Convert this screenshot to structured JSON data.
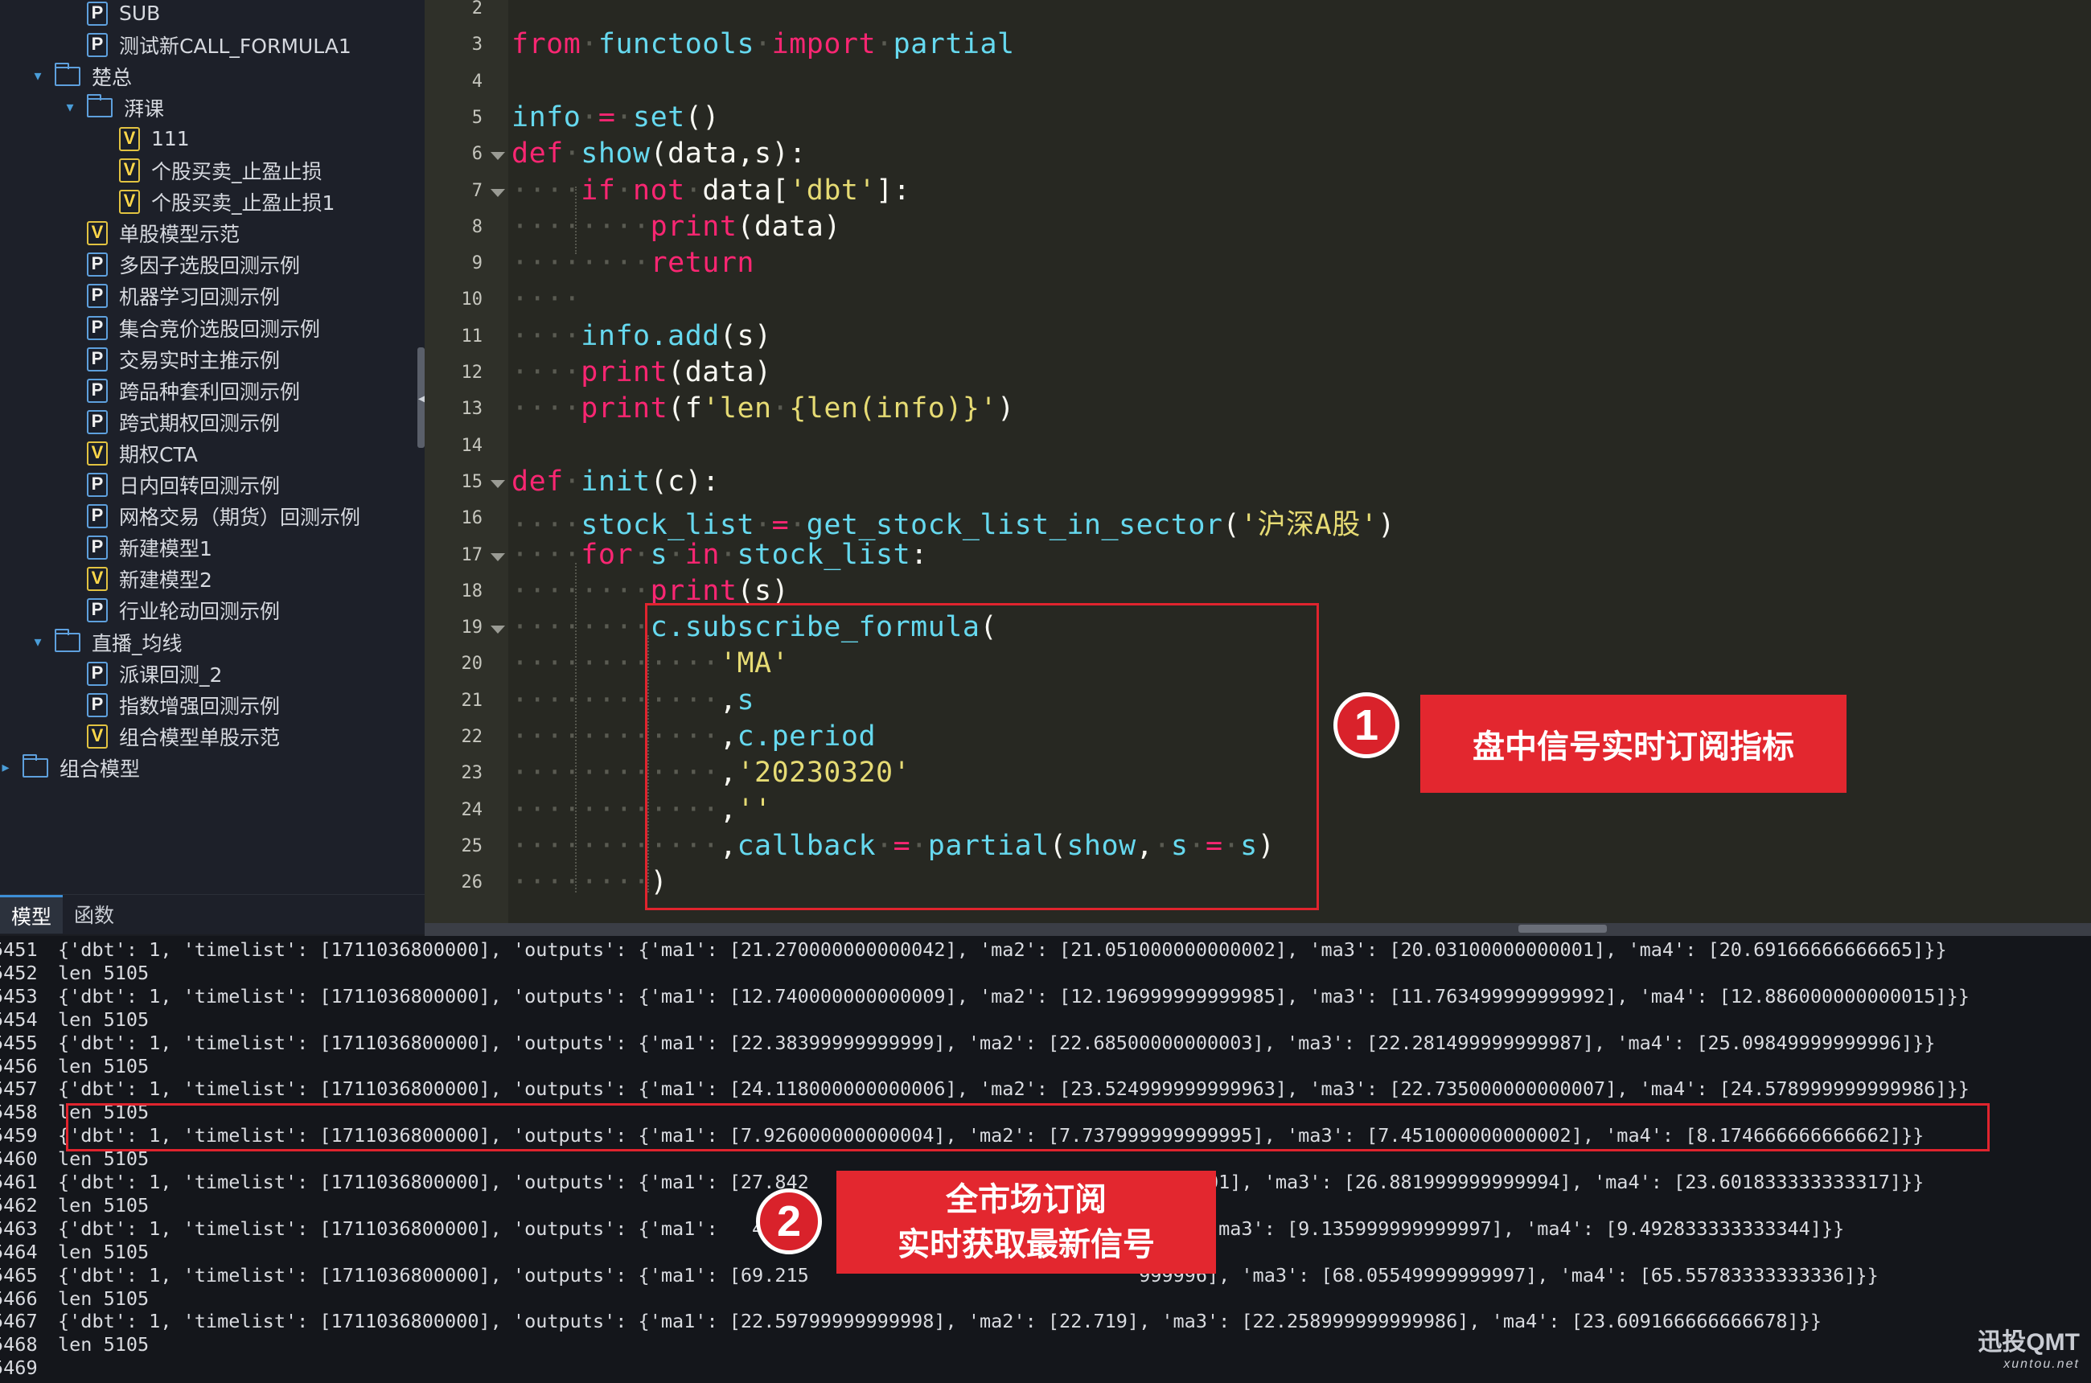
{
  "sidebar": {
    "tree": [
      {
        "label": "SUB",
        "type": "P",
        "expanded": null
      },
      {
        "label": "测试新CALL_FORMULA1",
        "type": "P",
        "expanded": null
      },
      {
        "label": "楚总",
        "type": "folder",
        "expanded": true
      },
      {
        "label": "湃课",
        "type": "folder",
        "expanded": true
      },
      {
        "label": "111",
        "type": "V",
        "expanded": null
      },
      {
        "label": "个股买卖_止盈止损",
        "type": "V",
        "expanded": null
      },
      {
        "label": "个股买卖_止盈止损1",
        "type": "V",
        "expanded": null
      },
      {
        "label": "单股模型示范",
        "type": "V",
        "expanded": null
      },
      {
        "label": "多因子选股回测示例",
        "type": "P",
        "expanded": null
      },
      {
        "label": "机器学习回测示例",
        "type": "P",
        "expanded": null
      },
      {
        "label": "集合竞价选股回测示例",
        "type": "P",
        "expanded": null
      },
      {
        "label": "交易实时主推示例",
        "type": "P",
        "expanded": null
      },
      {
        "label": "跨品种套利回测示例",
        "type": "P",
        "expanded": null
      },
      {
        "label": "跨式期权回测示例",
        "type": "P",
        "expanded": null
      },
      {
        "label": "期权CTA",
        "type": "V",
        "expanded": null
      },
      {
        "label": "日内回转回测示例",
        "type": "P",
        "expanded": null
      },
      {
        "label": "网格交易（期货）回测示例",
        "type": "P",
        "expanded": null
      },
      {
        "label": "新建模型1",
        "type": "P",
        "expanded": null
      },
      {
        "label": "新建模型2",
        "type": "V",
        "expanded": null
      },
      {
        "label": "行业轮动回测示例",
        "type": "P",
        "expanded": null
      },
      {
        "label": "直播_均线",
        "type": "folder",
        "expanded": true
      },
      {
        "label": "派课回测_2",
        "type": "P",
        "expanded": null
      },
      {
        "label": "指数增强回测示例",
        "type": "P",
        "expanded": null
      },
      {
        "label": "组合模型单股示范",
        "type": "V",
        "expanded": null
      },
      {
        "label": "组合模型",
        "type": "folder",
        "expanded": false
      }
    ],
    "tabs": [
      "模型",
      "函数"
    ]
  },
  "editor": {
    "lines": [
      {
        "n": "2",
        "fold": false,
        "tokens": []
      },
      {
        "n": "3",
        "fold": false,
        "tokens": [
          [
            "kw",
            "from"
          ],
          [
            "ws",
            "·"
          ],
          [
            "fn",
            "functools"
          ],
          [
            "ws",
            "·"
          ],
          [
            "kw",
            "import"
          ],
          [
            "ws",
            "·"
          ],
          [
            "fn",
            "partial"
          ]
        ]
      },
      {
        "n": "4",
        "fold": false,
        "tokens": []
      },
      {
        "n": "5",
        "fold": false,
        "tokens": [
          [
            "fn",
            "info"
          ],
          [
            "ws",
            "·"
          ],
          [
            "kw",
            "="
          ],
          [
            "ws",
            "·"
          ],
          [
            "fn",
            "set"
          ],
          [
            "t",
            "()"
          ]
        ]
      },
      {
        "n": "6",
        "fold": true,
        "tokens": [
          [
            "kw",
            "def"
          ],
          [
            "ws",
            "·"
          ],
          [
            "fn",
            "show"
          ],
          [
            "t",
            "(data,s):"
          ]
        ]
      },
      {
        "n": "7",
        "fold": true,
        "tokens": [
          [
            "ws",
            "····"
          ],
          [
            "kw",
            "if"
          ],
          [
            "ws",
            "·"
          ],
          [
            "kw",
            "not"
          ],
          [
            "ws",
            "·"
          ],
          [
            "t",
            "data["
          ],
          [
            "str",
            "'dbt'"
          ],
          [
            "t",
            "]:"
          ]
        ]
      },
      {
        "n": "8",
        "fold": false,
        "tokens": [
          [
            "ws",
            "········"
          ],
          [
            "kw",
            "print"
          ],
          [
            "t",
            "(data)"
          ]
        ]
      },
      {
        "n": "9",
        "fold": false,
        "tokens": [
          [
            "ws",
            "········"
          ],
          [
            "kw",
            "return"
          ]
        ]
      },
      {
        "n": "10",
        "fold": false,
        "tokens": [
          [
            "ws",
            "····"
          ]
        ]
      },
      {
        "n": "11",
        "fold": false,
        "tokens": [
          [
            "ws",
            "····"
          ],
          [
            "fn",
            "info.add"
          ],
          [
            "t",
            "(s)"
          ]
        ]
      },
      {
        "n": "12",
        "fold": false,
        "tokens": [
          [
            "ws",
            "····"
          ],
          [
            "kw",
            "print"
          ],
          [
            "t",
            "(data)"
          ]
        ]
      },
      {
        "n": "13",
        "fold": false,
        "tokens": [
          [
            "ws",
            "····"
          ],
          [
            "kw",
            "print"
          ],
          [
            "t",
            "(f"
          ],
          [
            "str",
            "'len"
          ],
          [
            "ws",
            "·"
          ],
          [
            "str",
            "{len(info)}'"
          ],
          [
            "t",
            ")"
          ]
        ]
      },
      {
        "n": "14",
        "fold": false,
        "tokens": []
      },
      {
        "n": "15",
        "fold": true,
        "tokens": [
          [
            "kw",
            "def"
          ],
          [
            "ws",
            "·"
          ],
          [
            "fn",
            "init"
          ],
          [
            "t",
            "(c):"
          ]
        ]
      },
      {
        "n": "16",
        "fold": false,
        "tokens": [
          [
            "ws",
            "····"
          ],
          [
            "fn",
            "stock_list"
          ],
          [
            "ws",
            "·"
          ],
          [
            "kw",
            "="
          ],
          [
            "ws",
            "·"
          ],
          [
            "fn",
            "get_stock_list_in_sector"
          ],
          [
            "t",
            "("
          ],
          [
            "str",
            "'沪深A股'"
          ],
          [
            "t",
            ")"
          ]
        ]
      },
      {
        "n": "17",
        "fold": true,
        "tokens": [
          [
            "ws",
            "····"
          ],
          [
            "kw",
            "for"
          ],
          [
            "ws",
            "·"
          ],
          [
            "fn",
            "s"
          ],
          [
            "ws",
            "·"
          ],
          [
            "kw",
            "in"
          ],
          [
            "ws",
            "·"
          ],
          [
            "fn",
            "stock_list"
          ],
          [
            "t",
            ":"
          ]
        ]
      },
      {
        "n": "18",
        "fold": false,
        "tokens": [
          [
            "ws",
            "········"
          ],
          [
            "kw",
            "print"
          ],
          [
            "t",
            "(s)"
          ]
        ]
      },
      {
        "n": "19",
        "fold": true,
        "tokens": [
          [
            "ws",
            "········"
          ],
          [
            "fn",
            "c.subscribe_formula"
          ],
          [
            "t",
            "("
          ]
        ]
      },
      {
        "n": "20",
        "fold": false,
        "tokens": [
          [
            "ws",
            "············"
          ],
          [
            "str",
            "'MA'"
          ]
        ]
      },
      {
        "n": "21",
        "fold": false,
        "tokens": [
          [
            "ws",
            "············"
          ],
          [
            "t",
            ","
          ],
          [
            "fn",
            "s"
          ]
        ]
      },
      {
        "n": "22",
        "fold": false,
        "tokens": [
          [
            "ws",
            "············"
          ],
          [
            "t",
            ","
          ],
          [
            "fn",
            "c.period"
          ]
        ]
      },
      {
        "n": "23",
        "fold": false,
        "tokens": [
          [
            "ws",
            "············"
          ],
          [
            "t",
            ","
          ],
          [
            "str",
            "'20230320'"
          ]
        ]
      },
      {
        "n": "24",
        "fold": false,
        "tokens": [
          [
            "ws",
            "············"
          ],
          [
            "t",
            ","
          ],
          [
            "str",
            "''"
          ]
        ]
      },
      {
        "n": "25",
        "fold": false,
        "tokens": [
          [
            "ws",
            "············"
          ],
          [
            "t",
            ","
          ],
          [
            "fn",
            "callback"
          ],
          [
            "ws",
            "·"
          ],
          [
            "kw",
            "="
          ],
          [
            "ws",
            "·"
          ],
          [
            "fn",
            "partial"
          ],
          [
            "t",
            "("
          ],
          [
            "fn",
            "show"
          ],
          [
            "t",
            ","
          ],
          [
            "ws",
            "·"
          ],
          [
            "fn",
            "s"
          ],
          [
            "ws",
            "·"
          ],
          [
            "kw",
            "="
          ],
          [
            "ws",
            "·"
          ],
          [
            "fn",
            "s"
          ],
          [
            "t",
            ")"
          ]
        ]
      },
      {
        "n": "26",
        "fold": false,
        "tokens": [
          [
            "ws",
            "········"
          ],
          [
            "t",
            ")"
          ]
        ]
      }
    ]
  },
  "console": {
    "lines": [
      {
        "n": "5451",
        "text": "{'dbt': 1, 'timelist': [1711036800000], 'outputs': {'ma1': [21.270000000000042], 'ma2': [21.051000000000002], 'ma3': [20.03100000000001], 'ma4': [20.69166666666665]}}"
      },
      {
        "n": "5452",
        "text": "len 5105"
      },
      {
        "n": "5453",
        "text": "{'dbt': 1, 'timelist': [1711036800000], 'outputs': {'ma1': [12.740000000000009], 'ma2': [12.196999999999985], 'ma3': [11.763499999999992], 'ma4': [12.886000000000015]}}"
      },
      {
        "n": "5454",
        "text": "len 5105"
      },
      {
        "n": "5455",
        "text": "{'dbt': 1, 'timelist': [1711036800000], 'outputs': {'ma1': [22.38399999999999], 'ma2': [22.68500000000003], 'ma3': [22.281499999999987], 'ma4': [25.09849999999996]}}"
      },
      {
        "n": "5456",
        "text": "len 5105"
      },
      {
        "n": "5457",
        "text": "{'dbt': 1, 'timelist': [1711036800000], 'outputs': {'ma1': [24.118000000000006], 'ma2': [23.524999999999963], 'ma3': [22.735000000000007], 'ma4': [24.578999999999986]}}"
      },
      {
        "n": "5458",
        "text": "len 5105"
      },
      {
        "n": "5459",
        "text": "{'dbt': 1, 'timelist': [1711036800000], 'outputs': {'ma1': [7.926000000000004], 'ma2': [7.737999999999995], 'ma3': [7.451000000000002], 'ma4': [8.174666666666662]}}"
      },
      {
        "n": "5460",
        "text": "len 5105"
      },
      {
        "n": "5461",
        "text": "{'dbt': 1, 'timelist': [1711036800000], 'outputs': {'ma1': [27.842                               000001], 'ma3': [26.881999999999994], 'ma4': [23.601833333333317]}}"
      },
      {
        "n": "5462",
        "text": "len 5105"
      },
      {
        "n": "5463",
        "text": "{'dbt': 1, 'timelist': [1711036800000], 'outputs': {'ma1':   4                              000001], 'ma3': [9.135999999999997], 'ma4': [9.492833333333344]}}"
      },
      {
        "n": "5464",
        "text": "len 5105"
      },
      {
        "n": "5465",
        "text": "{'dbt': 1, 'timelist': [1711036800000], 'outputs': {'ma1': [69.215                             999996], 'ma3': [68.05549999999997], 'ma4': [65.55783333333336]}}"
      },
      {
        "n": "5466",
        "text": "len 5105"
      },
      {
        "n": "5467",
        "text": "{'dbt': 1, 'timelist': [1711036800000], 'outputs': {'ma1': [22.59799999999998], 'ma2': [22.719], 'ma3': [22.258999999999986], 'ma4': [23.609166666666678]}}"
      },
      {
        "n": "5468",
        "text": "len 5105"
      },
      {
        "n": "5469",
        "text": ""
      }
    ]
  },
  "annotations": {
    "badge1": "1",
    "callout1": "盘中信号实时订阅指标",
    "badge2": "2",
    "callout2_line1": "全市场订阅",
    "callout2_line2": "实时获取最新信号"
  },
  "watermark": {
    "name": "迅投QMT",
    "url": "xuntou.net"
  },
  "colors": {
    "keyword": "#f92672",
    "function": "#66d9ef",
    "string": "#e6db74",
    "highlight": "#e0242e"
  }
}
